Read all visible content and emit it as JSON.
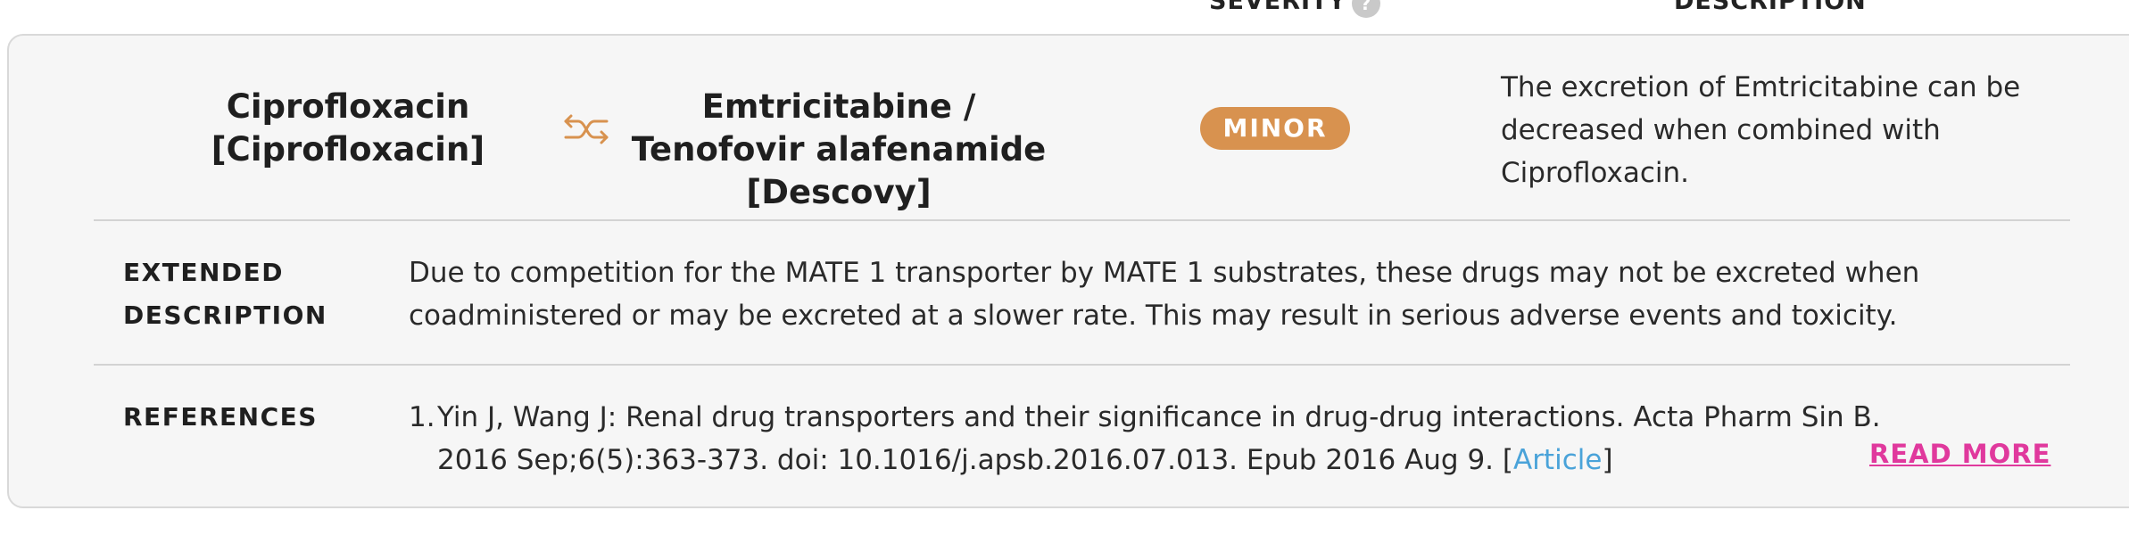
{
  "headers": {
    "severity": "SEVERITY",
    "description": "DESCRIPTION",
    "help_glyph": "?"
  },
  "interaction": {
    "drug_a": "Ciprofloxacin [Ciprofloxacin]",
    "drug_b": "Emtricitabine / Tenofovir alafenamide [Descovy]",
    "swap_icon": "swap-arrows-icon",
    "severity": "MINOR",
    "severity_color": "#d8924f",
    "summary": "The excretion of Emtricitabine can be decreased when combined with Ciprofloxacin."
  },
  "extended": {
    "label": "EXTENDED DESCRIPTION",
    "text": "Due to competition for the MATE 1 transporter by MATE 1 substrates, these drugs may not be excreted when coadministered or may be excreted at a slower rate. This may result in serious adverse events and toxicity."
  },
  "references": {
    "label": "REFERENCES",
    "items": [
      {
        "number": "1.",
        "text": "Yin J, Wang J: Renal drug transporters and their significance in drug-drug interactions. Acta Pharm Sin B. 2016 Sep;6(5):363-373. doi: 10.1016/j.apsb.2016.07.013. Epub 2016 Aug 9. [",
        "link_label": "Article",
        "suffix": "]"
      }
    ],
    "read_more": "READ MORE",
    "link_color": "#4aa3d9",
    "read_more_color": "#e0399d"
  }
}
